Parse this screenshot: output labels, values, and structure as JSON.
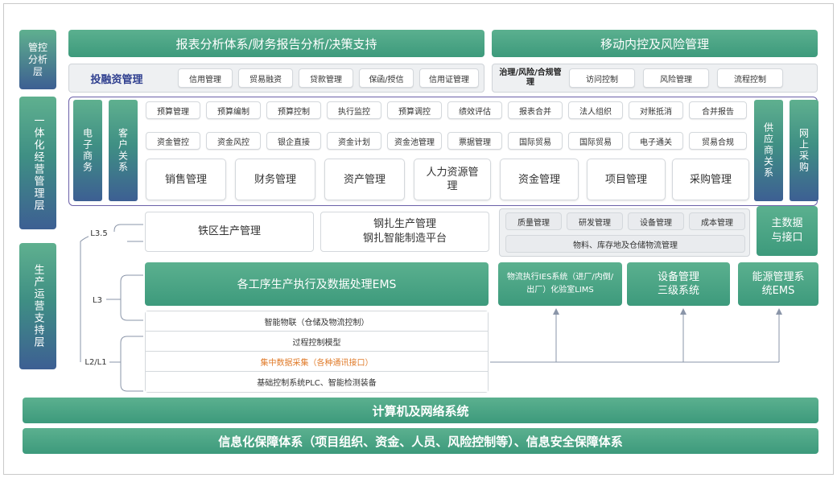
{
  "layers": {
    "mgmt": "管控分析层",
    "integrated": "一体化经营管理层",
    "production": "生产运营支持层"
  },
  "top": {
    "left_banner": "报表分析体系/财务报告分析/决策支持",
    "right_banner": "移动内控及风险管理",
    "investment_title": "投融资管理",
    "investment_items": [
      "信用管理",
      "贸易融资",
      "贷款管理",
      "保函/授信",
      "信用证管理"
    ],
    "risk_title": "治理/风险/合规管理",
    "risk_items": [
      "访问控制",
      "风险管理",
      "流程控制"
    ]
  },
  "integrated": {
    "left_tiles": [
      "电子商务",
      "客户关系"
    ],
    "right_tiles": [
      "供应商关系",
      "网上采购"
    ],
    "row1": [
      "预算管理",
      "预算编制",
      "预算控制",
      "执行监控",
      "预算调控",
      "绩效评估",
      "报表合并",
      "法人组织",
      "对账抵消",
      "合并报告"
    ],
    "row2": [
      "资金管控",
      "资金风控",
      "银企直接",
      "资金计划",
      "资金池管理",
      "票据管理",
      "国际贸易",
      "国际贸易",
      "电子通关",
      "贸易合规"
    ],
    "modules": [
      "销售管理",
      "财务管理",
      "资产管理",
      "人力资源管理",
      "资金管理",
      "项目管理",
      "采购管理"
    ]
  },
  "l35": {
    "label": "L3.5",
    "iron": "铁区生产管理",
    "steel_line1": "钢扎生产管理",
    "steel_line2": "钢扎智能制造平台",
    "quality_items": [
      "质量管理",
      "研发管理",
      "设备管理",
      "成本管理"
    ],
    "logistics": "物料、库存地及仓储物流管理",
    "master_data": "主数据与接口"
  },
  "l3": {
    "label": "L3",
    "ems": "各工序生产执行及数据处理EMS",
    "logistics_system": "物流执行IES系统（进厂/内倒/出厂）化验室LIMS",
    "equipment": "设备管理三级系统",
    "energy": "能源管理系统EMS"
  },
  "l2": {
    "label": "L2/L1",
    "rows": [
      "智能物联（仓储及物流控制）",
      "过程控制模型",
      "集中数据采集（各种通讯接口）",
      "基础控制系统PLC、智能检测装备"
    ]
  },
  "bottom": {
    "network": "计算机及网络系统",
    "security": "信息化保障体系（项目组织、资金、人员、风险控制等）、信息安全保障体系"
  },
  "colors": {
    "green": "#3d9a7c",
    "purple": "#3d5f93",
    "highlight": "#e07b2a"
  }
}
